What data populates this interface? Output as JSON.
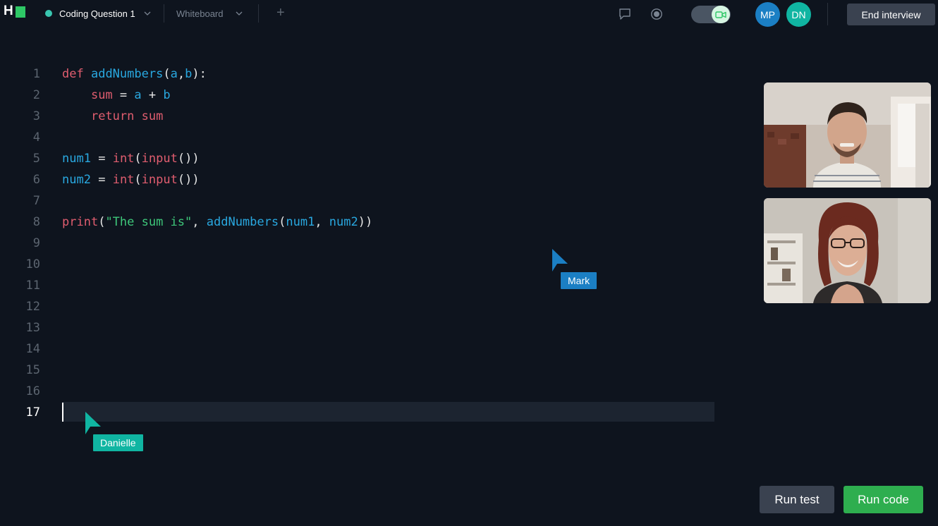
{
  "topbar": {
    "logo_text": "H",
    "tab_active_label": "Coding Question 1",
    "tab_whiteboard_label": "Whiteboard",
    "add_tab_symbol": "+",
    "participants": [
      {
        "initials": "MP",
        "color": "#1b7fc4"
      },
      {
        "initials": "DN",
        "color": "#10b5a2"
      }
    ],
    "end_button_label": "End interview"
  },
  "editor": {
    "line_numbers": [
      "1",
      "2",
      "3",
      "4",
      "5",
      "6",
      "7",
      "8",
      "9",
      "10",
      "11",
      "12",
      "13",
      "14",
      "15",
      "16",
      "17"
    ],
    "active_line": "17",
    "lines": [
      "def addNumbers(a,b):",
      "    sum = a + b",
      "    return sum",
      "",
      "num1 = int(input())",
      "num2 = int(input())",
      "",
      "print(\"The sum is\", addNumbers(num1, num2))",
      "",
      "",
      "",
      "",
      "",
      "",
      "",
      "",
      ""
    ]
  },
  "remote_cursors": [
    {
      "name": "Mark",
      "color": "#1b7fc4"
    },
    {
      "name": "Danielle",
      "color": "#10b5a2"
    }
  ],
  "actions": {
    "run_test_label": "Run test",
    "run_code_label": "Run code"
  },
  "colors": {
    "background": "#0e141e",
    "keyword": "#e05d6f",
    "identifier": "#29a8e0",
    "string": "#3ec77a",
    "run_code": "#2eae4f"
  }
}
